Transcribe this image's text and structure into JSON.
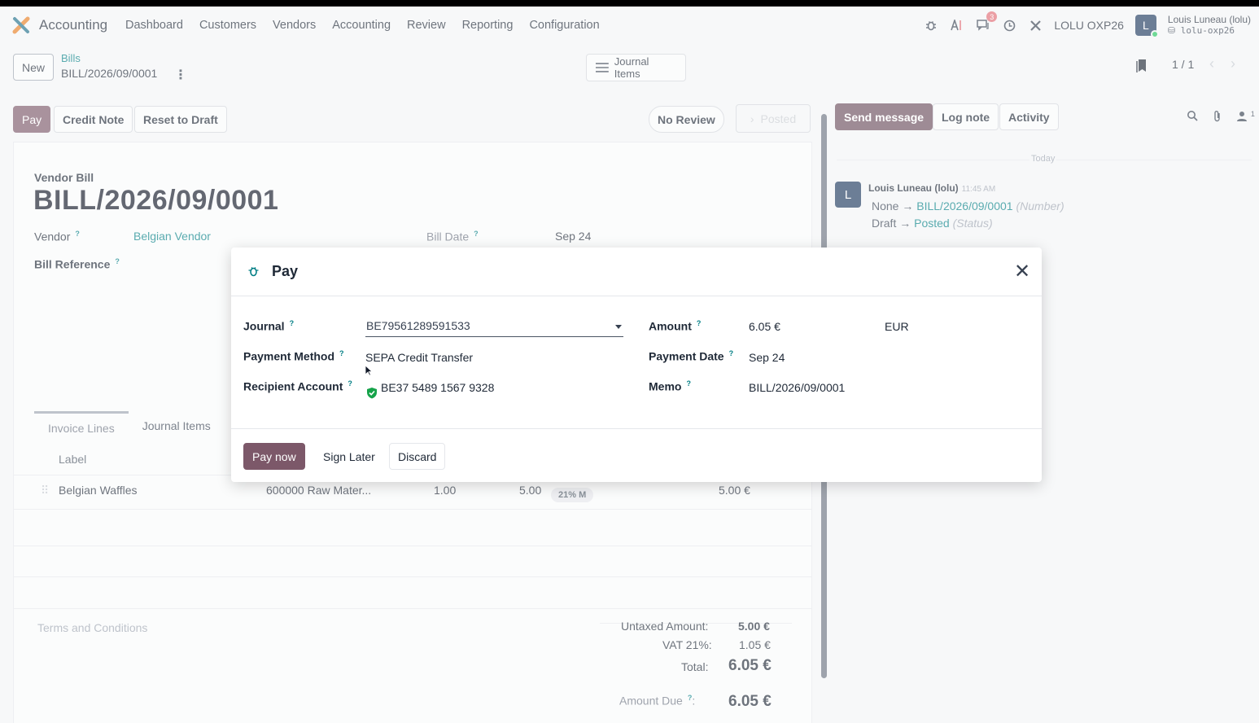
{
  "navbar": {
    "app_name": "Accounting",
    "menu": [
      "Dashboard",
      "Customers",
      "Vendors",
      "Accounting",
      "Review",
      "Reporting",
      "Configuration"
    ],
    "icons": [
      "bug-icon",
      "ai-icon",
      "chat-icon",
      "clock-icon",
      "tools-icon"
    ],
    "chat_badge": "3",
    "company": "LOLU OXP26",
    "user_initial": "L",
    "user_name": "Louis Luneau (lolu)",
    "user_db": "lolu-oxp26"
  },
  "control": {
    "new_label": "New",
    "breadcrumb_parent": "Bills",
    "breadcrumb_current": "BILL/2026/09/0001",
    "journal_items_label": "Journal Items",
    "pager": "1 / 1"
  },
  "actions": {
    "pay": "Pay",
    "credit_note": "Credit Note",
    "reset_to_draft": "Reset to Draft",
    "no_review": "No Review",
    "posted": "Posted"
  },
  "form": {
    "doc_type": "Vendor Bill",
    "doc_name": "BILL/2026/09/0001",
    "vendor_label": "Vendor",
    "vendor_value": "Belgian Vendor",
    "bill_date_label": "Bill Date",
    "bill_date_value": "Sep 24",
    "bill_reference_label": "Bill Reference",
    "tabs": [
      "Invoice Lines",
      "Journal Items"
    ],
    "column_label": "Label",
    "line": {
      "label": "Belgian Waffles",
      "account": "600000 Raw Mater...",
      "quantity": "1.00",
      "price": "5.00",
      "tax": "21% M",
      "subtotal": "5.00 €"
    },
    "terms": "Terms and Conditions",
    "totals": {
      "untaxed_label": "Untaxed Amount:",
      "untaxed_value": "5.00 €",
      "vat_label": "VAT 21%:",
      "vat_value": "1.05 €",
      "total_label": "Total:",
      "total_value": "6.05 €",
      "due_label": "Amount Due",
      "due_colon": ":",
      "due_value": "6.05 €"
    }
  },
  "chatter": {
    "send_message": "Send message",
    "log_note": "Log note",
    "activity": "Activity",
    "follower_count": "1",
    "today": "Today",
    "message": {
      "avatar": "L",
      "author": "Louis Luneau (lolu)",
      "time": "11:45 AM",
      "line1_old": "None",
      "line1_new": "BILL/2026/09/0001",
      "line1_field": "(Number)",
      "line2_old": "Draft",
      "line2_new": "Posted",
      "line2_field": "(Status)"
    }
  },
  "modal": {
    "title": "Pay",
    "journal_label": "Journal",
    "journal_value": "BE79561289591533",
    "payment_method_label": "Payment Method",
    "payment_method_value": "SEPA Credit Transfer",
    "recipient_label": "Recipient Account",
    "recipient_value": "BE37 5489 1567 9328",
    "amount_label": "Amount",
    "amount_value": "6.05 €",
    "currency": "EUR",
    "payment_date_label": "Payment Date",
    "payment_date_value": "Sep 24",
    "memo_label": "Memo",
    "memo_value": "BILL/2026/09/0001",
    "pay_now": "Pay now",
    "sign_later": "Sign Later",
    "discard": "Discard"
  },
  "colors": {
    "primary": "#7c5869",
    "link": "#017e84"
  }
}
